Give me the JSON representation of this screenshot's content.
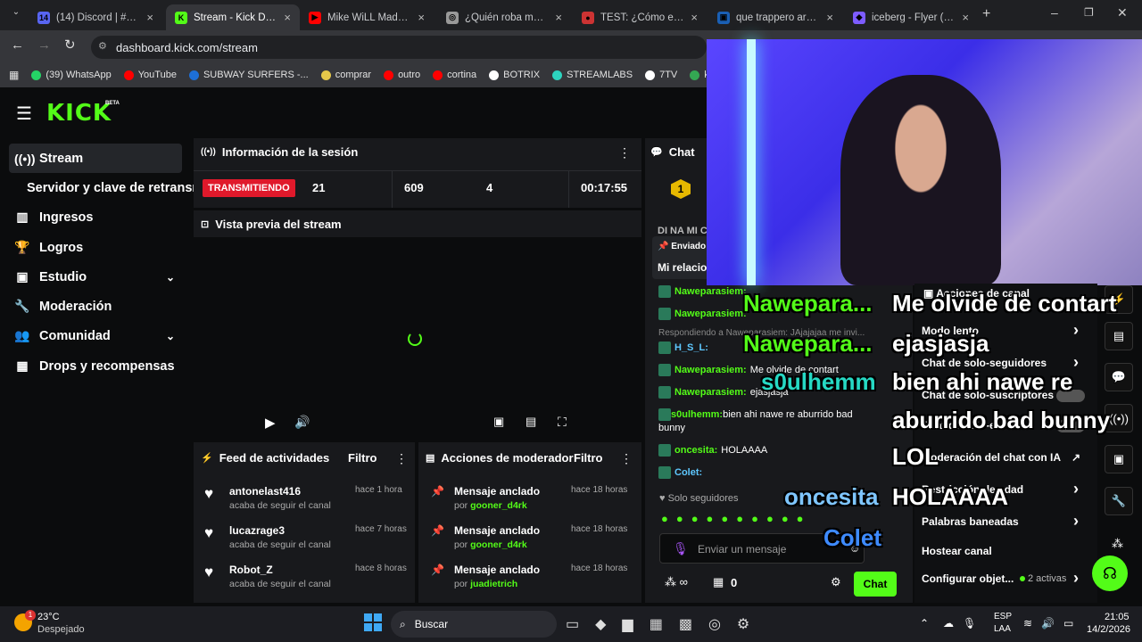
{
  "browser": {
    "tabs": [
      {
        "title": "(14) Discord | #gener",
        "fav": "#5865f2",
        "fx": "14"
      },
      {
        "title": "Stream - Kick Dashb",
        "fav": "#53fc18",
        "fx": "K"
      },
      {
        "title": "Mike WiLL Made-It -",
        "fav": "#ff0000",
        "fx": "▶"
      },
      {
        "title": "¿Quién roba más? -",
        "fav": "#999",
        "fx": "◎"
      },
      {
        "title": "TEST: ¿Cómo es tu P",
        "fav": "#c33",
        "fx": "●"
      },
      {
        "title": "que trappero argent",
        "fav": "#1a5fb4",
        "fx": "▣"
      },
      {
        "title": "iceberg - Flyer (A4)",
        "fav": "#7d5cff",
        "fx": "◆"
      }
    ],
    "url": "dashboard.kick.com/stream",
    "bookmarks": [
      "(39) WhatsApp",
      "YouTube",
      "SUBWAY SURFERS -...",
      "comprar",
      "outro",
      "cortina",
      "BOTRIX",
      "STREAMLABS",
      "7TV",
      "kick - G"
    ],
    "bookmark_colors": [
      "#25d366",
      "#ff0000",
      "#1d6fd8",
      "#e6c84a",
      "#ff0000",
      "#ff0000",
      "#fff",
      "#2dd4bf",
      "#fff",
      "#34a853"
    ]
  },
  "kick": {
    "logo": "KICK",
    "beta": "BETA",
    "nav": [
      "Stream",
      "Servidor y clave de retransm",
      "Ingresos",
      "Logros",
      "Estudio",
      "Moderación",
      "Comunidad",
      "Drops y recompensas"
    ],
    "session": {
      "title": "Información de la sesión",
      "status": "TRANSMITIENDO",
      "viewers": "21",
      "followers": "609",
      "subs": "4",
      "time": "00:17:55"
    },
    "preview": {
      "title": "Vista previa del stream"
    },
    "feed": {
      "title": "Feed de actividades",
      "filter": "Filtro",
      "items": [
        {
          "user": "antonelast416",
          "sub": "acaba de seguir el canal",
          "time": "hace 1 hora"
        },
        {
          "user": "lucazrage3",
          "sub": "acaba de seguir el canal",
          "time": "hace 7 horas"
        },
        {
          "user": "Robot_Z",
          "sub": "acaba de seguir el canal",
          "time": "hace 8 horas"
        }
      ]
    },
    "mod": {
      "title": "Acciones de moderador",
      "filter": "Filtro",
      "items": [
        {
          "action": "Mensaje anclado",
          "by": "por",
          "user": "gooner_d4rk",
          "time": "hace 18 horas"
        },
        {
          "action": "Mensaje anclado",
          "by": "por",
          "user": "gooner_d4rk",
          "time": "hace 18 horas"
        },
        {
          "action": "Mensaje anclado",
          "by": "por",
          "user": "juadietrich",
          "time": "hace 18 horas"
        }
      ]
    },
    "chat": {
      "title": "Chat",
      "pinned_label": "Enviado",
      "pinned_text": "Mi relacio",
      "top": "DI NA MI C",
      "lines": [
        {
          "user": "Naweparasiem:",
          "msg": ""
        },
        {
          "user": "Naweparasiem:",
          "msg": ""
        },
        {
          "user": "",
          "msg": "Respondiendo a Naweparasiem: JAjajajaa me invi..."
        },
        {
          "user": "H_S_L:",
          "msg": ""
        },
        {
          "user": "Naweparasiem:",
          "msg": "Me olvide de contart"
        },
        {
          "user": "Naweparasiem:",
          "msg": "ejasjasja"
        },
        {
          "user": "s0ulhemm:",
          "msg": "bien ahi nawe re aburrido bad bunny"
        },
        {
          "user": "oncesita:",
          "msg": "HOLAAAA"
        },
        {
          "user": "Colet:",
          "msg": ""
        }
      ],
      "followers_only": "Solo seguidores",
      "placeholder": "Enviar un mensaje",
      "send": "Chat",
      "count": "0"
    },
    "overlay": {
      "names": [
        "Nawepara...",
        "Nawepara...",
        "s0ulhemm",
        "oncesita",
        "Colet"
      ],
      "texts": [
        "Me olvide de contart",
        "ejasjasja",
        "bien ahi nawe re",
        "aburrido bad bunny",
        "LOL",
        "HOLAAAA"
      ]
    },
    "channel": {
      "title": "Acciones de canal",
      "items": [
        "Modo lento",
        "Chat de solo-seguidores",
        "Chat de solo-suscriptores",
        "Chat de solo-emotes",
        "Moderación del chat con IA",
        "Restricción de edad",
        "Palabras baneadas",
        "Hostear canal",
        "Configurar objet..."
      ],
      "active": "2 activas"
    }
  },
  "taskbar": {
    "weather": "23°C",
    "weather_sub": "Despejado",
    "search": "Buscar",
    "lang": "ESP",
    "lang2": "LAA",
    "time": "21:05",
    "date": "14/2/2026"
  }
}
